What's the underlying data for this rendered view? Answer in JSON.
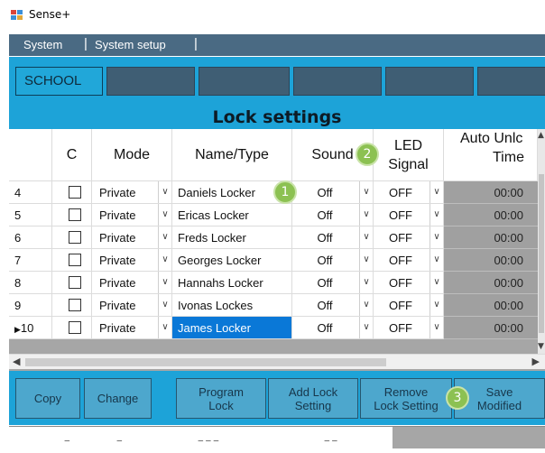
{
  "window": {
    "title": "Sense+"
  },
  "menu": {
    "items": [
      "System",
      "System setup"
    ],
    "separator": "|"
  },
  "tabs": {
    "active_label": "SCHOOL"
  },
  "section": {
    "title": "Lock settings"
  },
  "grid": {
    "headers": {
      "c": "C",
      "mode": "Mode",
      "name_type": "Name/Type",
      "sound": "Sound",
      "led_signal_line1": "LED",
      "led_signal_line2": "Signal",
      "auto_unlock_line1": "Auto Unlc",
      "auto_unlock_line2": "Time"
    },
    "rows": [
      {
        "num": "4",
        "mode": "Private",
        "name": "Daniels Locker",
        "sound": "Off",
        "led": "OFF",
        "time": "00:00",
        "selected": false,
        "current": false
      },
      {
        "num": "5",
        "mode": "Private",
        "name": "Ericas Locker",
        "sound": "Off",
        "led": "OFF",
        "time": "00:00",
        "selected": false,
        "current": false
      },
      {
        "num": "6",
        "mode": "Private",
        "name": "Freds Locker",
        "sound": "Off",
        "led": "OFF",
        "time": "00:00",
        "selected": false,
        "current": false
      },
      {
        "num": "7",
        "mode": "Private",
        "name": "Georges Locker",
        "sound": "Off",
        "led": "OFF",
        "time": "00:00",
        "selected": false,
        "current": false
      },
      {
        "num": "8",
        "mode": "Private",
        "name": "Hannahs Locker",
        "sound": "Off",
        "led": "OFF",
        "time": "00:00",
        "selected": false,
        "current": false
      },
      {
        "num": "9",
        "mode": "Private",
        "name": "Ivonas Lockes",
        "sound": "Off",
        "led": "OFF",
        "time": "00:00",
        "selected": false,
        "current": false
      },
      {
        "num": "10",
        "mode": "Private",
        "name": "James Locker",
        "sound": "Off",
        "led": "OFF",
        "time": "00:00",
        "selected": true,
        "current": true
      }
    ],
    "current_row_marker": "▶"
  },
  "buttons": {
    "copy": "Copy",
    "change": "Change",
    "program_lock_1": "Program",
    "program_lock_2": "Lock",
    "add_lock_1": "Add Lock",
    "add_lock_2": "Setting",
    "remove_lock_1": "Remove",
    "remove_lock_2": "Lock Setting",
    "save_1": "Save",
    "save_2": "Modified"
  },
  "callouts": [
    "1",
    "2",
    "3"
  ],
  "colors": {
    "accent": "#1da3d8",
    "menu_bg": "#4a6a83",
    "selected_cell": "#0a78d7",
    "callout": "#8cc152"
  },
  "icons": {
    "dropdown": "chevron-down-icon",
    "scroll_up": "triangle-up-icon",
    "scroll_down": "triangle-down-icon",
    "scroll_left": "triangle-left-icon",
    "scroll_right": "triangle-right-icon"
  }
}
